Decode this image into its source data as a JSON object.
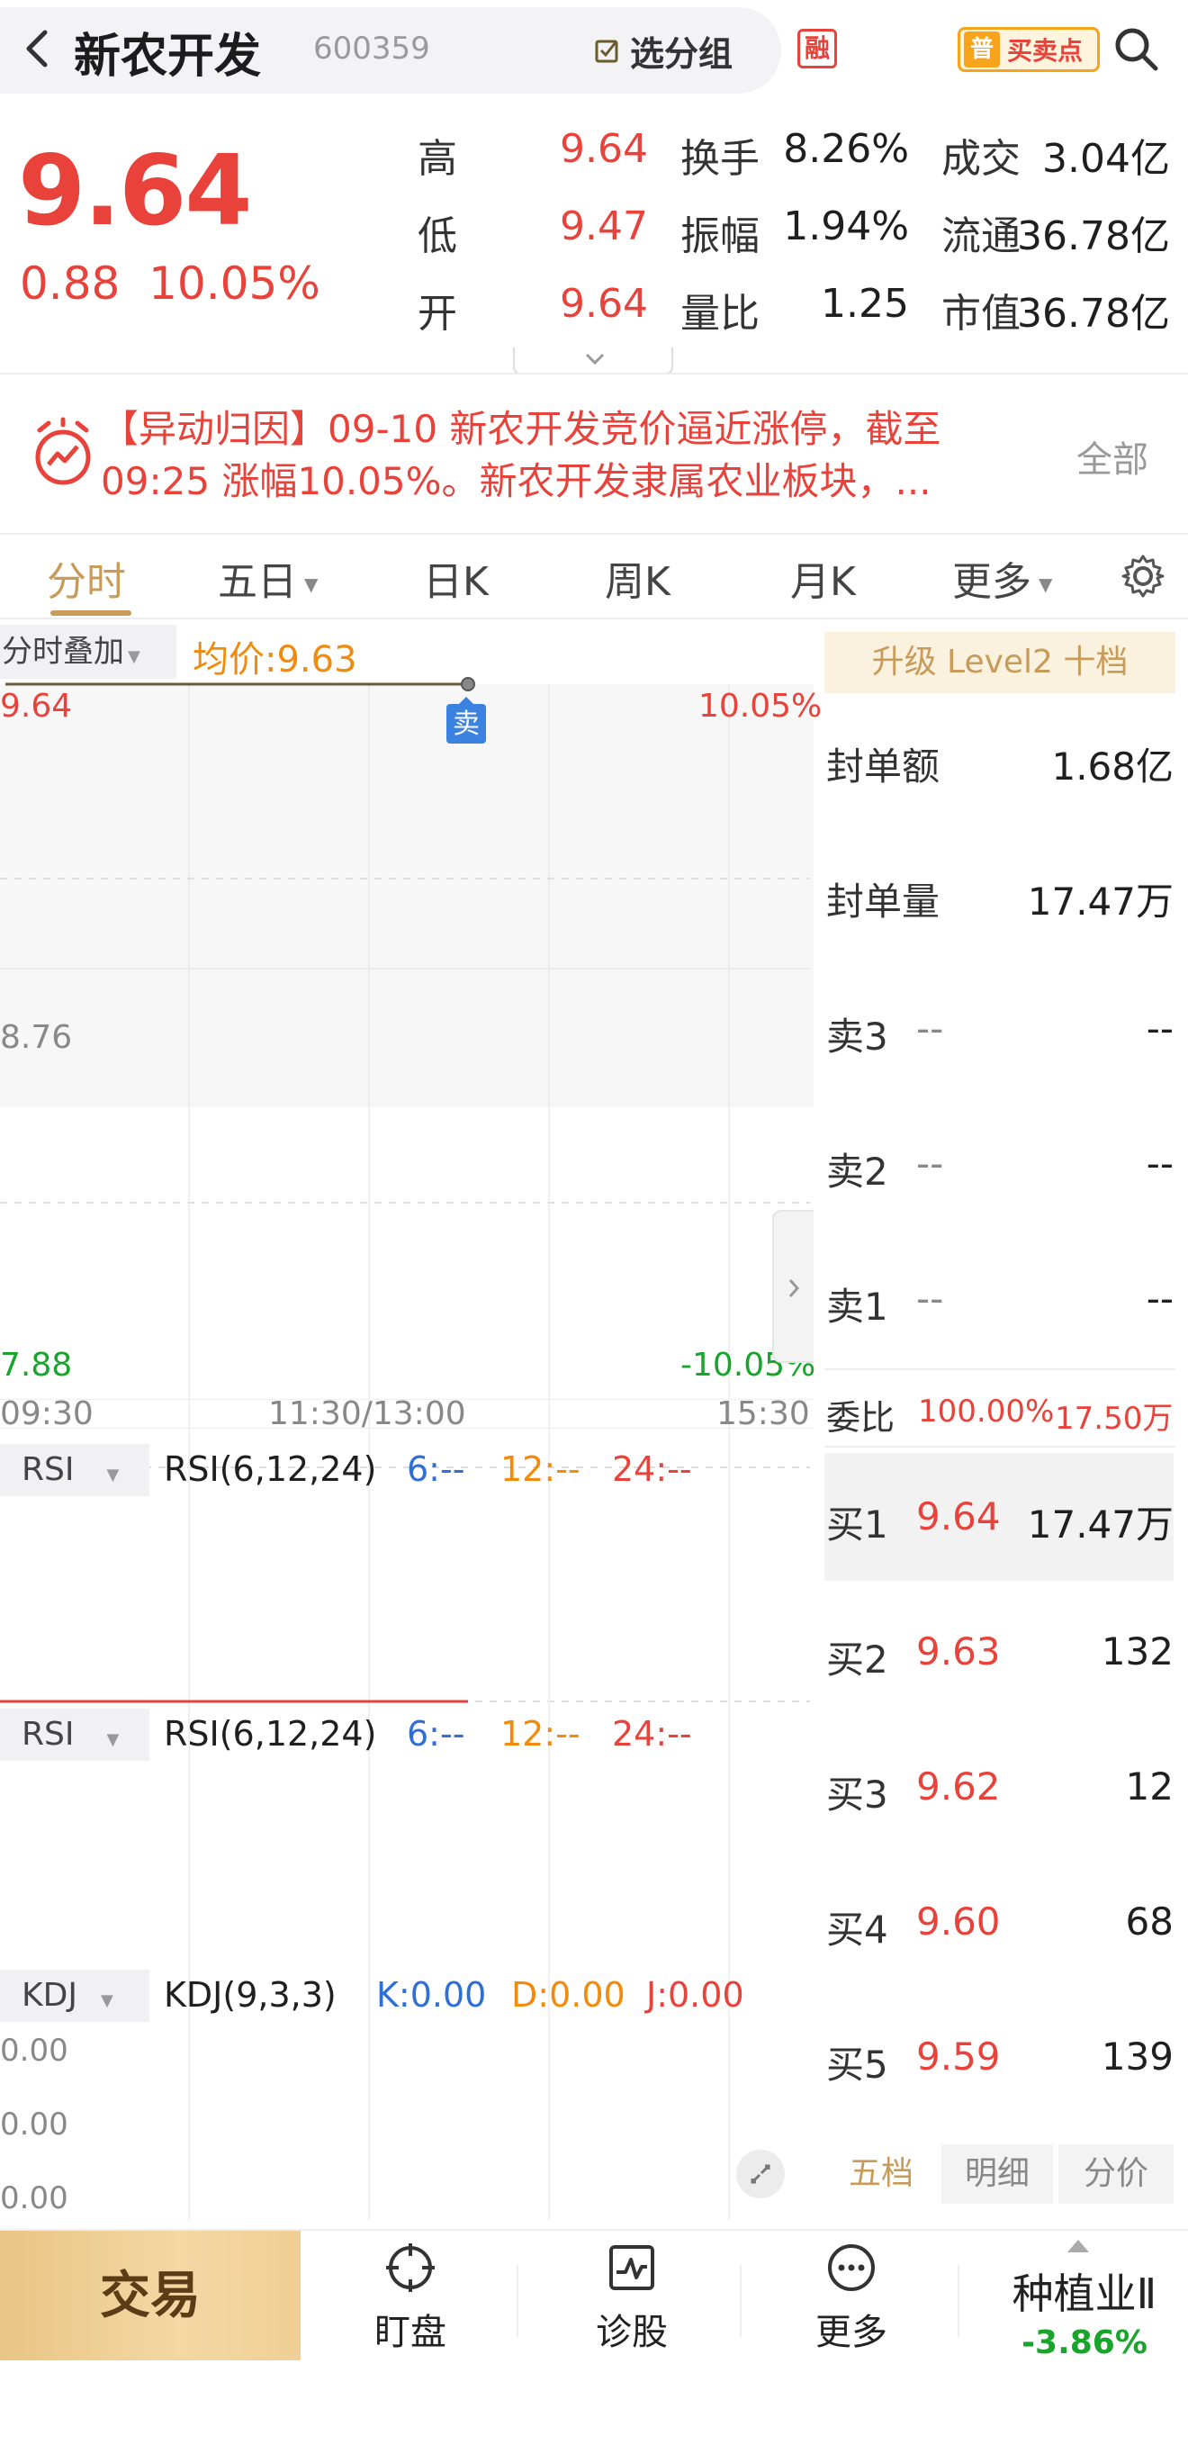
{
  "header": {
    "back_label": "<",
    "stock_name": "新农开发",
    "stock_code": "600359",
    "group_button": "选分组",
    "rong_badge": "融",
    "buysell_prefix": "普",
    "buysell_label": "买卖点"
  },
  "quote": {
    "price": "9.64",
    "change": "0.88",
    "change_pct": "10.05%",
    "stats": [
      {
        "label": "高",
        "value": "9.64"
      },
      {
        "label": "低",
        "value": "9.47"
      },
      {
        "label": "开",
        "value": "9.64"
      }
    ],
    "stats2": [
      {
        "label": "换手",
        "value": "8.26%"
      },
      {
        "label": "振幅",
        "value": "1.94%"
      },
      {
        "label": "量比",
        "value": "1.25"
      }
    ],
    "stats3": [
      {
        "label": "成交",
        "value": "3.04亿"
      },
      {
        "label": "流通",
        "value": "36.78亿"
      },
      {
        "label": "市值",
        "value": "36.78亿"
      }
    ]
  },
  "news": {
    "text": "【异动归因】09-10 新农开发竞价逼近涨停，截至 09:25 涨幅10.05%。新农开发隶属农业板块，...",
    "all_label": "全部"
  },
  "tabs": [
    "分时",
    "五日",
    "日K",
    "周K",
    "月K",
    "更多"
  ],
  "chart": {
    "overlay_label": "分时叠加",
    "avg_price_label": "均价:9.63",
    "y_top": "9.64",
    "y_mid": "8.76",
    "y_bottom": "7.88",
    "pct_top": "10.05%",
    "pct_bottom": "-10.05%",
    "x_labels": [
      "09:30",
      "11:30/13:00",
      "15:30"
    ],
    "sell_marker": "卖",
    "indicators": [
      {
        "button": "RSI",
        "name": "RSI(6,12,24)",
        "v1": "6:--",
        "v2": "12:--",
        "v3": "24:--"
      },
      {
        "button": "RSI",
        "name": "RSI(6,12,24)",
        "v1": "6:--",
        "v2": "12:--",
        "v3": "24:--"
      },
      {
        "button": "KDJ",
        "name": "KDJ(9,3,3)",
        "v1": "K:0.00",
        "v2": "D:0.00",
        "v3": "J:0.00"
      }
    ],
    "kdj_axis": [
      "0.00",
      "0.00",
      "0.00"
    ]
  },
  "chart_data": {
    "type": "line",
    "title": "",
    "x": [
      "09:30"
    ],
    "series": [
      {
        "name": "",
        "values": [
          9.64
        ]
      },
      {
        "name": "均价",
        "values": [
          9.63
        ]
      }
    ],
    "ylim": [
      7.88,
      9.64
    ],
    "xlabel": "",
    "ylabel": ""
  },
  "order_book": {
    "level2_button": "升级 Level2 十档",
    "seal_amount_label": "封单额",
    "seal_amount": "1.68亿",
    "seal_volume_label": "封单量",
    "seal_volume": "17.47万",
    "sells": [
      {
        "label": "卖3",
        "price": "--",
        "vol": "--"
      },
      {
        "label": "卖2",
        "price": "--",
        "vol": "--"
      },
      {
        "label": "卖1",
        "price": "--",
        "vol": "--"
      }
    ],
    "ratio_label": "委比",
    "ratio_pct": "100.00%",
    "ratio_vol": "17.50万",
    "buys": [
      {
        "label": "买1",
        "price": "9.64",
        "vol": "17.47万"
      },
      {
        "label": "买2",
        "price": "9.63",
        "vol": "132"
      },
      {
        "label": "买3",
        "price": "9.62",
        "vol": "12"
      },
      {
        "label": "买4",
        "price": "9.60",
        "vol": "68"
      },
      {
        "label": "买5",
        "price": "9.59",
        "vol": "139"
      }
    ],
    "bottom_tabs": [
      "五档",
      "明细",
      "分价"
    ]
  },
  "bottom_nav": {
    "trade": "交易",
    "watch": "盯盘",
    "diagnose": "诊股",
    "more": "更多",
    "sector": "种植业Ⅱ",
    "sector_change": "-3.86%"
  },
  "colors": {
    "up": "#e8423a",
    "down": "#19a52b",
    "accent": "#c89b58",
    "avg": "#f08b0e"
  }
}
